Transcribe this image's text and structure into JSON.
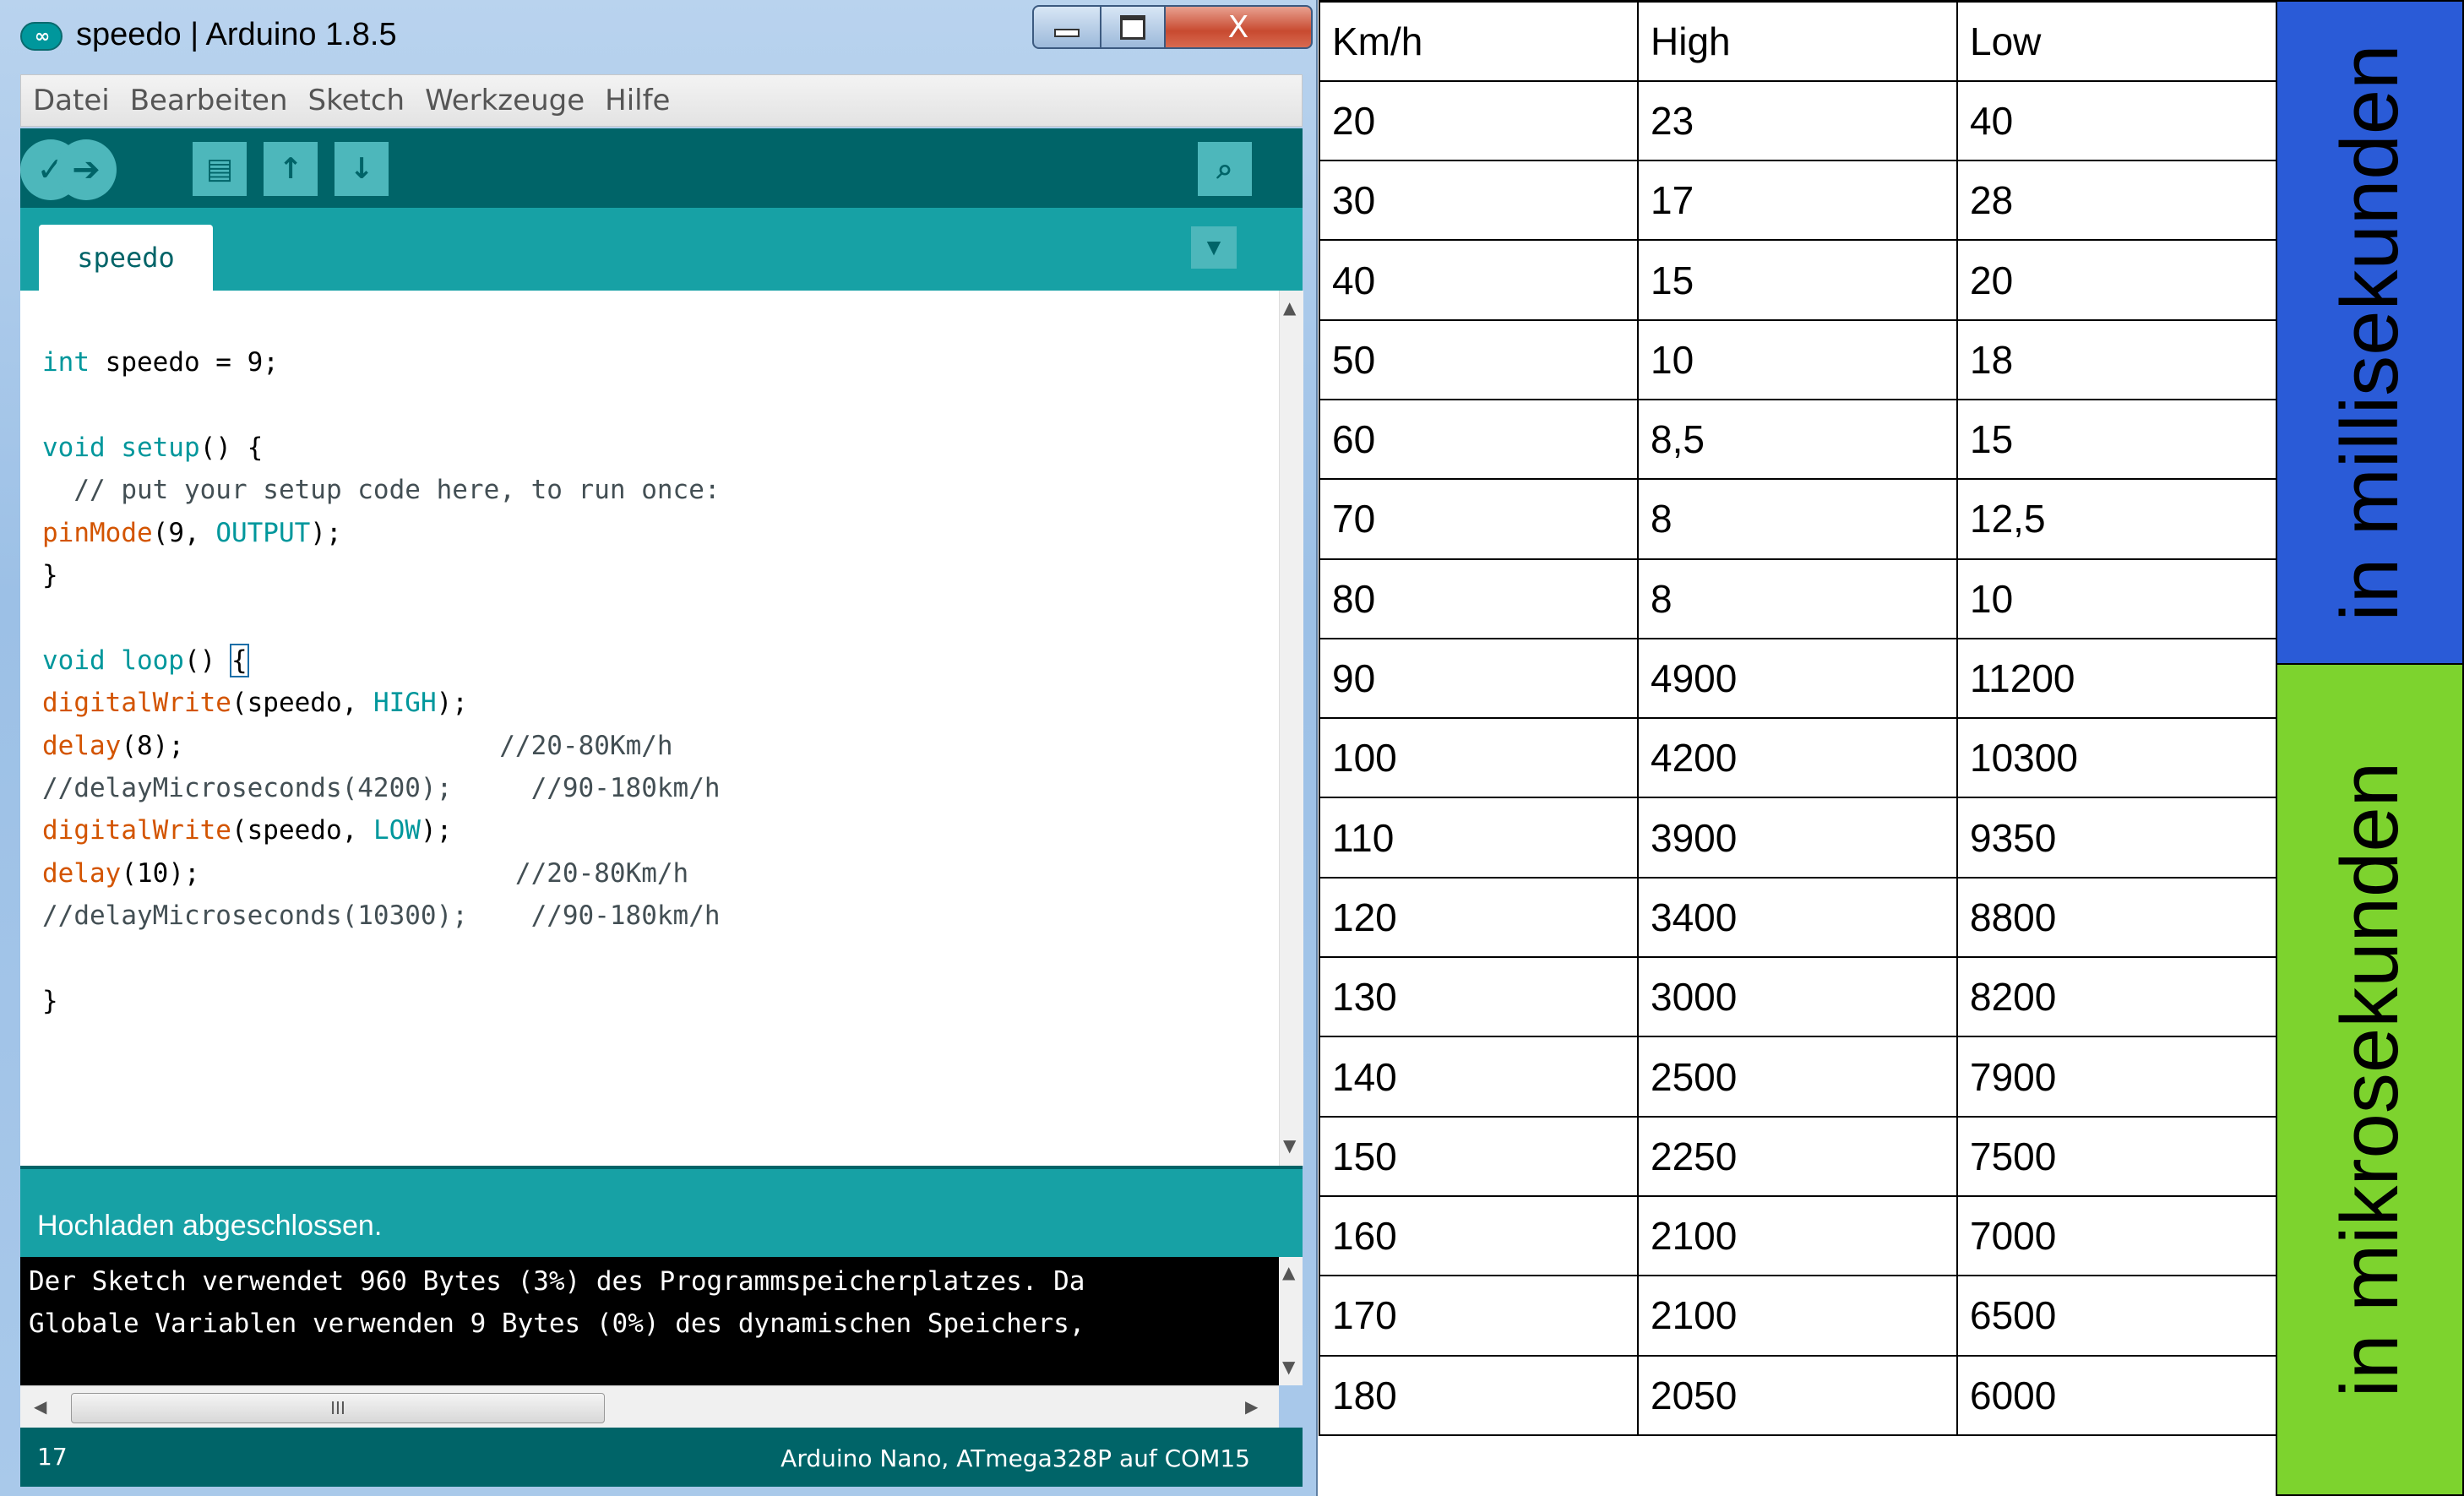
{
  "window": {
    "title": "speedo | Arduino 1.8.5",
    "logo_glyph": "∞",
    "minimize_icon": "minimize-icon",
    "maximize_icon": "maximize-icon",
    "close_glyph": "X"
  },
  "menu": [
    "Datei",
    "Bearbeiten",
    "Sketch",
    "Werkzeuge",
    "Hilfe"
  ],
  "toolbar": {
    "verify_glyph": "✓",
    "upload_glyph": "➔",
    "new_glyph": "▤",
    "open_glyph": "↑",
    "save_glyph": "↓",
    "serial_monitor_glyph": "⌕"
  },
  "tab": {
    "label": "speedo",
    "menu_glyph": "▼"
  },
  "code_lines": {
    "l1_kw": "int",
    "l1_rest": " speedo = 9;",
    "l3_kw": "void",
    "l3_fn": " setup",
    "l3_rest": "() {",
    "l4": "  // put your setup code here, to run once:",
    "l5_fn": "pinMode",
    "l5_a": "(9, ",
    "l5_const": "OUTPUT",
    "l5_b": ");",
    "l6": "}",
    "l8_kw": "void",
    "l8_fn": " loop",
    "l8_rest": "() ",
    "l8_brace": "{",
    "l9_fn": "digitalWrite",
    "l9_a": "(speedo, ",
    "l9_const": "HIGH",
    "l9_b": ");",
    "l10_fn": "delay",
    "l10_a": "(8);                    ",
    "l10_cm": "//20-80Km/h",
    "l11": "//delayMicroseconds(4200);     //90-180km/h",
    "l12_fn": "digitalWrite",
    "l12_a": "(speedo, ",
    "l12_const": "LOW",
    "l12_b": ");",
    "l13_fn": "delay",
    "l13_a": "(10);                    ",
    "l13_cm": "//20-80Km/h",
    "l14": "//delayMicroseconds(10300);    //90-180km/h",
    "l16": "}"
  },
  "status": {
    "message": "Hochladen abgeschlossen."
  },
  "console": {
    "line1": "Der Sketch verwendet 960 Bytes (3%) des Programmspeicherplatzes. Da",
    "line2": "Globale Variablen verwenden 9 Bytes (0%) des dynamischen Speichers,"
  },
  "scrollbar": {
    "thumb_grip": "III",
    "left_arrow": "◀",
    "right_arrow": "▶",
    "up_arrow": "▲",
    "down_arrow": "▼"
  },
  "footer": {
    "line_number": "17",
    "board": "Arduino Nano, ATmega328P auf COM15"
  },
  "table": {
    "headers": [
      "Km/h",
      "High",
      "Low"
    ],
    "rows": [
      [
        "20",
        "23",
        "40"
      ],
      [
        "30",
        "17",
        "28"
      ],
      [
        "40",
        "15",
        "20"
      ],
      [
        "50",
        "10",
        "18"
      ],
      [
        "60",
        "8,5",
        "15"
      ],
      [
        "70",
        "8",
        "12,5"
      ],
      [
        "80",
        "8",
        "10"
      ],
      [
        "90",
        "4900",
        "11200"
      ],
      [
        "100",
        "4200",
        "10300"
      ],
      [
        "110",
        "3900",
        "9350"
      ],
      [
        "120",
        "3400",
        "8800"
      ],
      [
        "130",
        "3000",
        "8200"
      ],
      [
        "140",
        "2500",
        "7900"
      ],
      [
        "150",
        "2250",
        "7500"
      ],
      [
        "160",
        "2100",
        "7000"
      ],
      [
        "170",
        "2100",
        "6500"
      ],
      [
        "180",
        "2050",
        "6000"
      ]
    ],
    "band_milli": "in millisekunden",
    "band_micro": "in mikrosekunden"
  },
  "colors": {
    "arduino_teal_dark": "#006468",
    "arduino_teal": "#17a1a5",
    "band_milli": "#2a5bd7",
    "band_micro": "#7dd32e"
  }
}
